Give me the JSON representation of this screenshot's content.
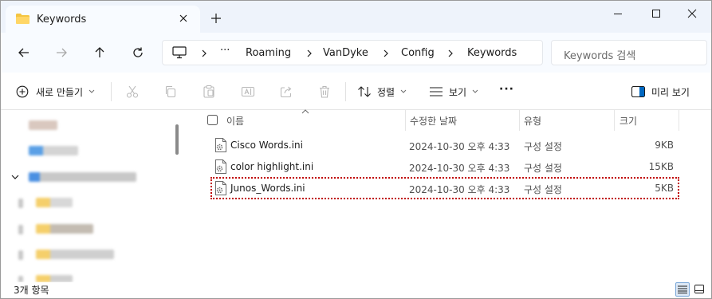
{
  "tab": {
    "title": "Keywords"
  },
  "address": {
    "ellipsis": "···",
    "segments": [
      "Roaming",
      "VanDyke",
      "Config",
      "Keywords"
    ]
  },
  "search": {
    "placeholder": "Keywords 검색"
  },
  "toolbar": {
    "new_label": "새로 만들기",
    "sort_label": "정렬",
    "view_label": "보기",
    "more_label": "···",
    "preview_label": "미리 보기"
  },
  "columns": {
    "name": "이름",
    "modified": "수정한 날짜",
    "type": "유형",
    "size": "크기"
  },
  "files": [
    {
      "name": "Cisco Words.ini",
      "modified": "2024-10-30 오후 4:33",
      "type": "구성 설정",
      "size": "9KB"
    },
    {
      "name": "color highlight.ini",
      "modified": "2024-10-30 오후 4:33",
      "type": "구성 설정",
      "size": "15KB"
    },
    {
      "name": "Junos_Words.ini",
      "modified": "2024-10-30 오후 4:33",
      "type": "구성 설정",
      "size": "5KB"
    }
  ],
  "status": {
    "item_count": "3개 항목"
  },
  "colors": {
    "accent": "#0067c0",
    "selection_outline": "#c00000",
    "folder": "#f4c542"
  }
}
